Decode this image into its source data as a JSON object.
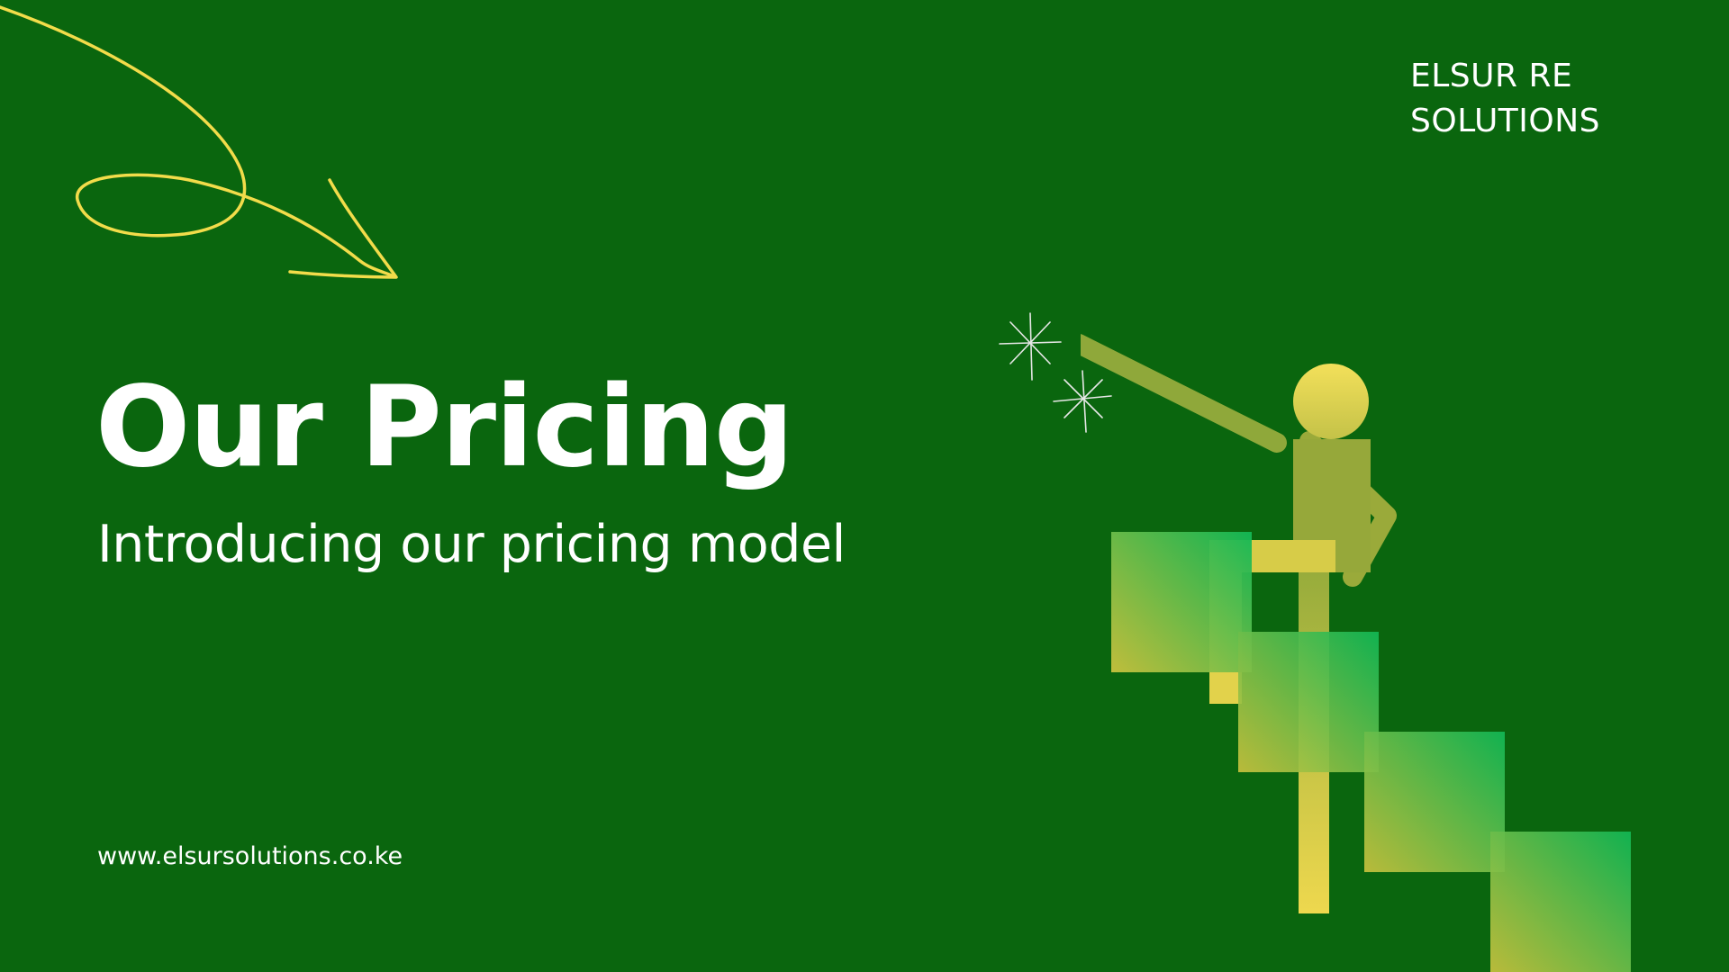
{
  "slide": {
    "brand_line1": "ELSUR RE",
    "brand_line2": "SOLUTIONS",
    "title": "Our Pricing",
    "subtitle": "Introducing our pricing model",
    "website": "www.elsursolutions.co.ke"
  },
  "colors": {
    "background": "#0a660e",
    "text": "#ffffff",
    "doodle": "#f2dc4a",
    "step_green": "#12b856",
    "step_yellow": "#c8c23e",
    "figure_olive": "#8fa83a",
    "figure_yellow": "#eed84e"
  },
  "icons": {
    "doodle": "curly-arrow-doodle",
    "sparkles": "sparkle-stars",
    "illustration": "person-climbing-stairs"
  }
}
